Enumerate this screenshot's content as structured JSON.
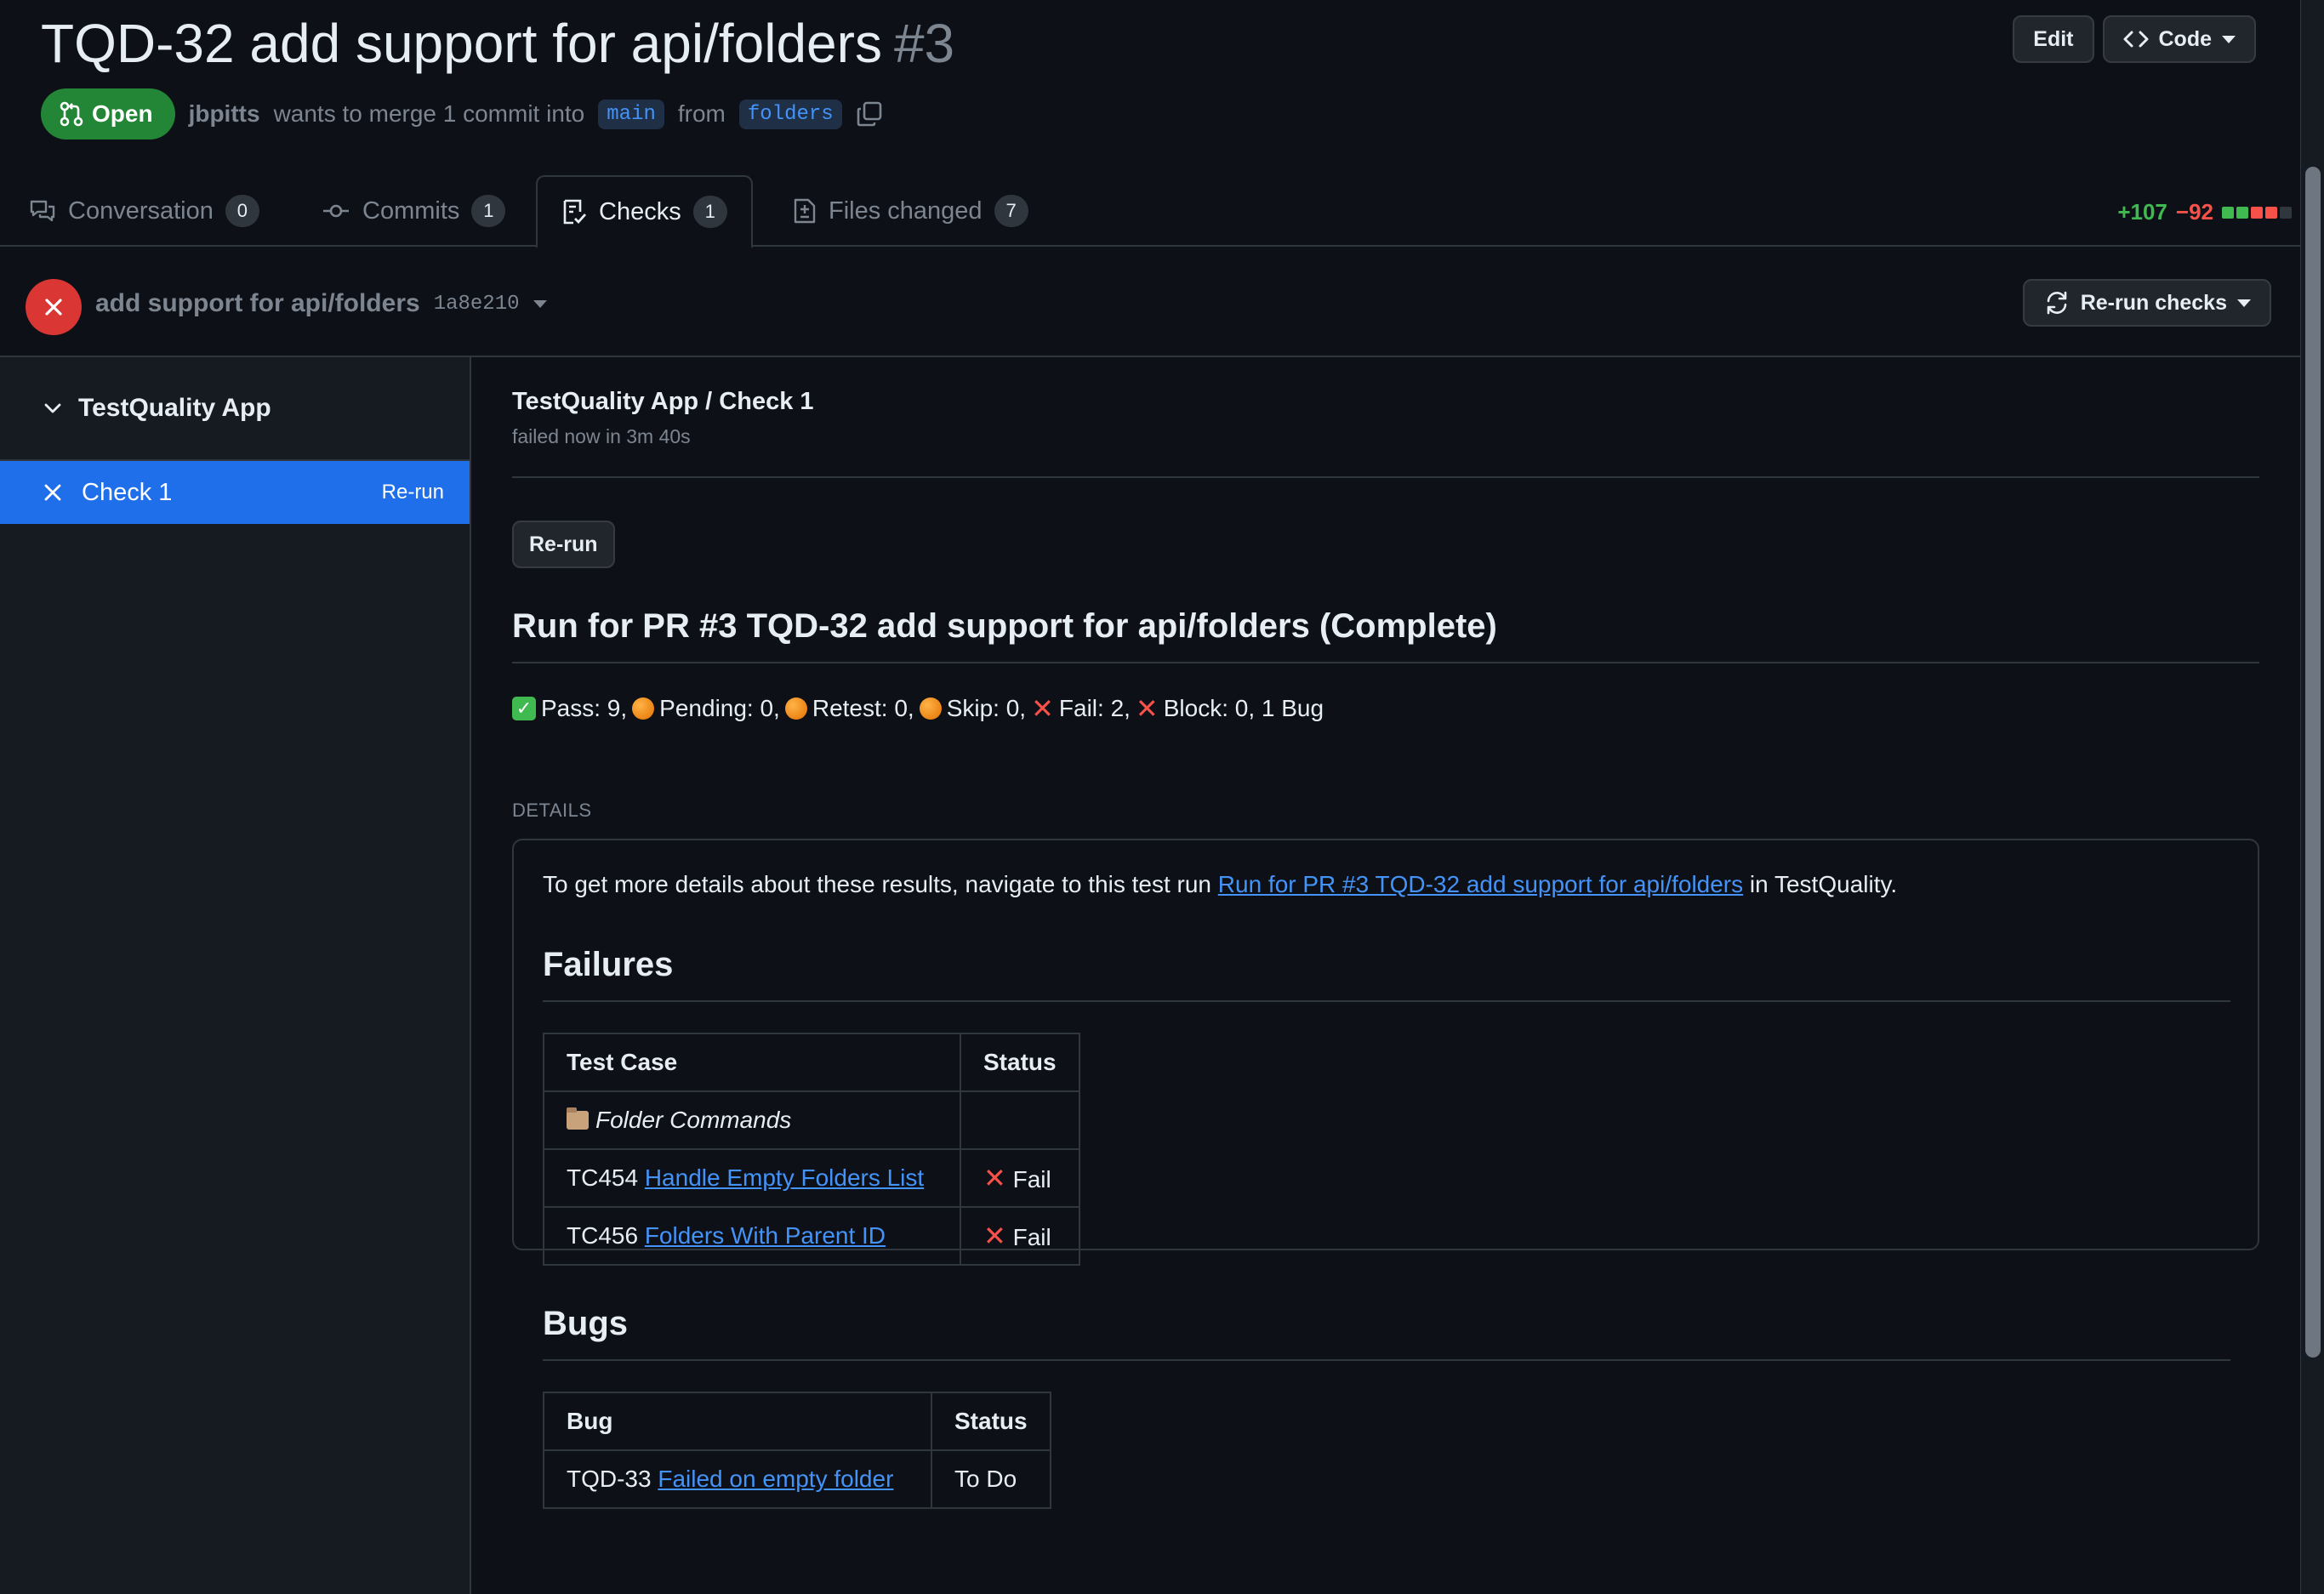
{
  "pr": {
    "title": "TQD-32 add support for api/folders",
    "number": "#3",
    "state": "Open",
    "author": "jbpitts",
    "merge_text": "wants to merge 1 commit into",
    "base_branch": "main",
    "from_text": "from",
    "head_branch": "folders"
  },
  "header_buttons": {
    "edit": "Edit",
    "code": "Code"
  },
  "tabs": [
    {
      "label": "Conversation",
      "count": "0"
    },
    {
      "label": "Commits",
      "count": "1"
    },
    {
      "label": "Checks",
      "count": "1"
    },
    {
      "label": "Files changed",
      "count": "7"
    }
  ],
  "diffstat": {
    "additions": "+107",
    "deletions": "−92"
  },
  "commit": {
    "message": "add support for api/folders",
    "sha": "1a8e210",
    "rerun_checks": "Re-run checks"
  },
  "sidebar": {
    "app_name": "TestQuality App",
    "check_name": "Check 1",
    "check_rerun": "Re-run"
  },
  "check": {
    "title": "TestQuality App / Check 1",
    "subtitle": "failed now in 3m 40s",
    "rerun": "Re-run",
    "run_heading": "Run for PR #3 TQD-32 add support for api/folders (Complete)",
    "summary": {
      "pass": "Pass: 9,",
      "pending": "Pending: 0,",
      "retest": "Retest: 0,",
      "skip": "Skip: 0,",
      "fail": "Fail: 2,",
      "block": "Block: 0, 1 Bug"
    },
    "details_label": "DETAILS",
    "details_intro": "To get more details about these results, navigate to this test run",
    "details_link": "Run for PR #3 TQD-32 add support for api/folders",
    "details_suffix": "in TestQuality.",
    "failures_heading": "Failures",
    "failures_table": {
      "headers": [
        "Test Case",
        "Status"
      ],
      "suite": "Folder Commands",
      "rows": [
        {
          "id": "TC454",
          "name": "Handle Empty Folders List",
          "status": "Fail"
        },
        {
          "id": "TC456",
          "name": "Folders With Parent ID",
          "status": "Fail"
        }
      ]
    },
    "bugs_heading": "Bugs",
    "bugs_table": {
      "headers": [
        "Bug",
        "Status"
      ],
      "rows": [
        {
          "id": "TQD-33",
          "name": "Failed on empty folder",
          "status": "To Do"
        }
      ]
    }
  },
  "icons": {
    "state": "git-pull-request-icon",
    "copy": "copy-icon",
    "conversation": "comment-discussion-icon",
    "commits": "git-commit-icon",
    "checks": "checklist-icon",
    "files": "file-diff-icon",
    "fail": "x-circle-icon",
    "sync": "sync-icon"
  },
  "colors": {
    "background": "#0d1117",
    "accent": "#1f6feb",
    "open_green": "#238636",
    "fail_red": "#da3633",
    "link": "#4493f8"
  }
}
